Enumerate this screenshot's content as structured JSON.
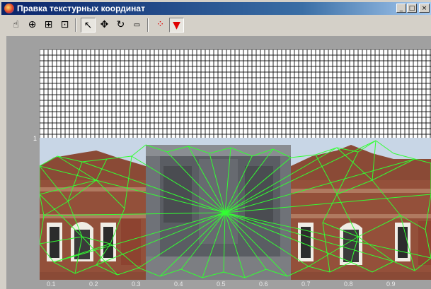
{
  "window": {
    "title": "Правка текстурных координат",
    "minimize_label": "_",
    "maximize_label": "□",
    "close_label": "×"
  },
  "toolbar": {
    "tools": [
      {
        "name": "pan-tool-icon",
        "glyph": "☝"
      },
      {
        "name": "zoom-in-icon",
        "glyph": "⊕"
      },
      {
        "name": "zoom-window-icon",
        "glyph": "⊞"
      },
      {
        "name": "zoom-extents-icon",
        "glyph": "⊡"
      },
      {
        "name": "select-arrow-icon",
        "glyph": "↖"
      },
      {
        "name": "move-icon",
        "glyph": "✥"
      },
      {
        "name": "rotate-icon",
        "glyph": "↻"
      },
      {
        "name": "scale-icon",
        "glyph": "▭"
      },
      {
        "name": "points-mode-icon",
        "glyph": "⁘"
      },
      {
        "name": "vertex-select-icon",
        "glyph": "▼"
      }
    ]
  },
  "plot": {
    "y_label": "1",
    "x_ticks": [
      "0.1",
      "0.2",
      "0.3",
      "0.4",
      "0.5",
      "0.6",
      "0.7",
      "0.8",
      "0.9"
    ],
    "colors": {
      "mesh": "#33ff33",
      "canvas": "#a0a0a0",
      "grid": "#000000",
      "accent": "#e00000"
    }
  }
}
